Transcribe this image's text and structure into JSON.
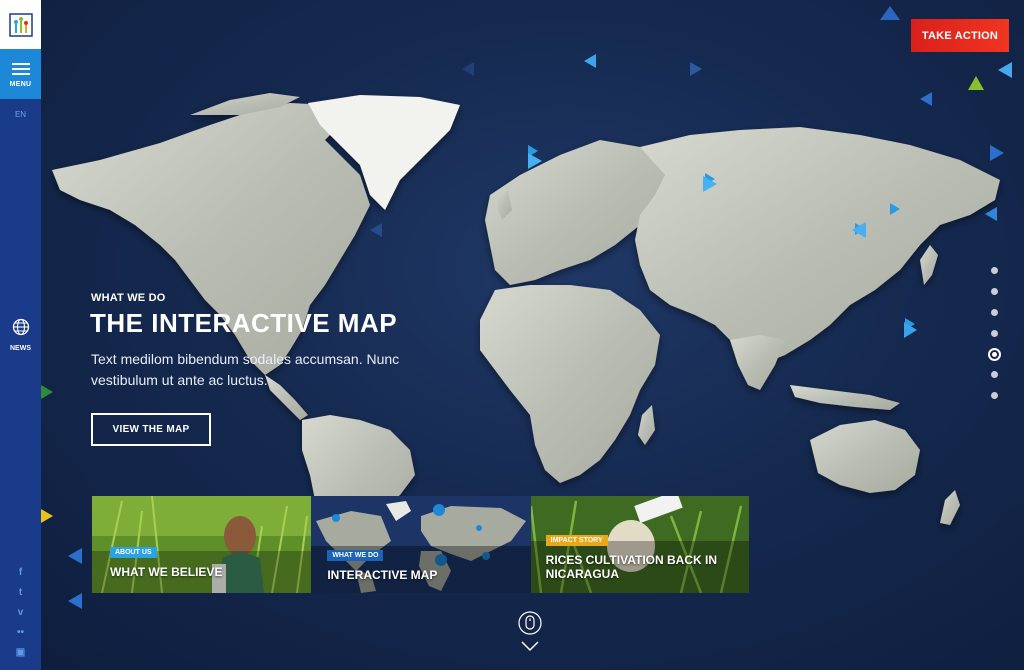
{
  "sidebar": {
    "menu_label": "MENU",
    "lang": "EN",
    "news_label": "NEWS",
    "social": [
      "f",
      "t",
      "v",
      "••",
      "▣"
    ]
  },
  "header": {
    "take_action": "TAKE ACTION"
  },
  "hero": {
    "kicker": "WHAT WE DO",
    "title": "THE INTERACTIVE MAP",
    "description": "Text medilom bibendum sodales accumsan. Nunc vestibulum ut ante ac luctus.",
    "cta": "VIEW THE MAP"
  },
  "cards": [
    {
      "badge": "ABOUT US",
      "title": "WHAT WE BELIEVE",
      "badge_color": "#2aa4e0"
    },
    {
      "badge": "WHAT WE DO",
      "title": "INTERACTIVE MAP",
      "badge_color": "#1c63b8"
    },
    {
      "badge": "IMPACT STORY",
      "title": "RICES CULTIVATION BACK IN NICARAGUA",
      "badge_color": "#e8a81a"
    }
  ],
  "pager": {
    "total": 7,
    "active": 5
  },
  "colors": {
    "accent": "#1e88d8",
    "action": "#e52b1e",
    "sidebar": "#1a3a8a"
  }
}
